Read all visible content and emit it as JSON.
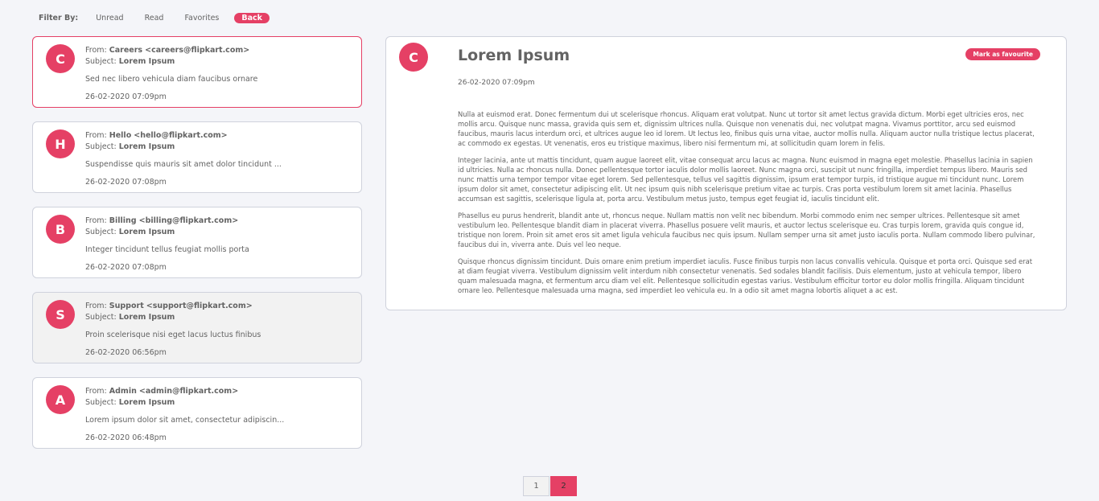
{
  "filter": {
    "label": "Filter By:",
    "options": [
      "Unread",
      "Read",
      "Favorites"
    ],
    "back_label": "Back"
  },
  "emails": [
    {
      "initial": "C",
      "from_label": "From:",
      "from_name": "Careers",
      "from_email": "<careers@flipkart.com>",
      "subject_label": "Subject:",
      "subject": "Lorem Ipsum",
      "excerpt": "Sed nec libero vehicula diam faucibus ornare",
      "date": "26-02-2020 07:09pm",
      "state": "selected"
    },
    {
      "initial": "H",
      "from_label": "From:",
      "from_name": "Hello",
      "from_email": "<hello@flipkart.com>",
      "subject_label": "Subject:",
      "subject": "Lorem Ipsum",
      "excerpt": "Suspendisse quis mauris sit amet dolor tincidunt ...",
      "date": "26-02-2020 07:08pm",
      "state": "unread"
    },
    {
      "initial": "B",
      "from_label": "From:",
      "from_name": "Billing",
      "from_email": "<billing@flipkart.com>",
      "subject_label": "Subject:",
      "subject": "Lorem Ipsum",
      "excerpt": "Integer tincidunt tellus feugiat mollis porta",
      "date": "26-02-2020 07:08pm",
      "state": "unread"
    },
    {
      "initial": "S",
      "from_label": "From:",
      "from_name": "Support",
      "from_email": "<support@flipkart.com>",
      "subject_label": "Subject:",
      "subject": "Lorem Ipsum",
      "excerpt": "Proin scelerisque nisi eget lacus luctus finibus",
      "date": "26-02-2020 06:56pm",
      "state": "read"
    },
    {
      "initial": "A",
      "from_label": "From:",
      "from_name": "Admin",
      "from_email": "<admin@flipkart.com>",
      "subject_label": "Subject:",
      "subject": "Lorem Ipsum",
      "excerpt": "Lorem ipsum dolor sit amet, consectetur adipiscin...",
      "date": "26-02-2020 06:48pm",
      "state": "unread"
    }
  ],
  "detail": {
    "initial": "C",
    "title": "Lorem Ipsum",
    "favourite_label": "Mark as favourite",
    "date": "26-02-2020 07:09pm",
    "paragraphs": [
      "Nulla at euismod erat. Donec fermentum dui ut scelerisque rhoncus. Aliquam erat volutpat. Nunc ut tortor sit amet lectus gravida dictum. Morbi eget ultricies eros, nec mollis arcu. Quisque nunc massa, gravida quis sem et, dignissim ultrices nulla. Quisque non venenatis dui, nec volutpat magna. Vivamus porttitor, arcu sed euismod faucibus, mauris lacus interdum orci, et ultrices augue leo id lorem. Ut lectus leo, finibus quis urna vitae, auctor mollis nulla. Aliquam auctor nulla tristique lectus placerat, ac commodo ex egestas. Ut venenatis, eros eu tristique maximus, libero nisi fermentum mi, at sollicitudin quam lorem in felis.",
      "Integer lacinia, ante ut mattis tincidunt, quam augue laoreet elit, vitae consequat arcu lacus ac magna. Nunc euismod in magna eget molestie. Phasellus lacinia in sapien id ultricies. Nulla ac rhoncus nulla. Donec pellentesque tortor iaculis dolor mollis laoreet. Nunc magna orci, suscipit ut nunc fringilla, imperdiet tempus libero. Mauris sed nunc mattis urna tempor tempor vitae eget lorem. Sed pellentesque, tellus vel sagittis dignissim, ipsum erat tempor turpis, id tristique augue mi tincidunt nunc. Lorem ipsum dolor sit amet, consectetur adipiscing elit. Ut nec ipsum quis nibh scelerisque pretium vitae ac turpis. Cras porta vestibulum lorem sit amet lacinia. Phasellus accumsan est sagittis, scelerisque ligula at, porta arcu. Vestibulum metus justo, tempus eget feugiat id, iaculis tincidunt elit.",
      "Phasellus eu purus hendrerit, blandit ante ut, rhoncus neque. Nullam mattis non velit nec bibendum. Morbi commodo enim nec semper ultrices. Pellentesque sit amet vestibulum leo. Pellentesque blandit diam in placerat viverra. Phasellus posuere velit mauris, et auctor lectus scelerisque eu. Cras turpis lorem, gravida quis congue id, tristique non lorem. Proin sit amet eros sit amet ligula vehicula faucibus nec quis ipsum. Nullam semper urna sit amet justo iaculis porta. Nullam commodo libero pulvinar, faucibus dui in, viverra ante. Duis vel leo neque.",
      "Quisque rhoncus dignissim tincidunt. Duis ornare enim pretium imperdiet iaculis. Fusce finibus turpis non lacus convallis vehicula. Quisque et porta orci. Quisque sed erat at diam feugiat viverra. Vestibulum dignissim velit interdum nibh consectetur venenatis. Sed sodales blandit facilisis. Duis elementum, justo at vehicula tempor, libero quam malesuada magna, et fermentum arcu diam vel elit. Pellentesque sollicitudin egestas varius. Vestibulum efficitur tortor eu dolor mollis fringilla. Aliquam tincidunt ornare leo. Pellentesque malesuada urna magna, sed imperdiet leo vehicula eu. In a odio sit amet magna lobortis aliquet a ac est."
    ]
  },
  "pagination": {
    "pages": [
      "1",
      "2"
    ],
    "current": "2"
  },
  "colors": {
    "accent": "#e54065",
    "background": "#f4f5f9",
    "border": "#cfd2dc",
    "read_background": "#f2f2f2",
    "text": "#636363"
  }
}
